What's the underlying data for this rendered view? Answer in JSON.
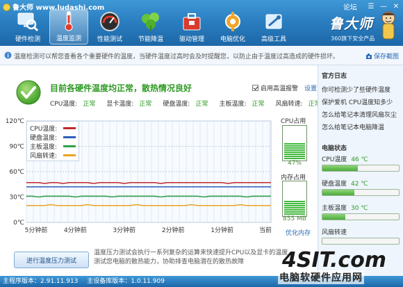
{
  "app": {
    "title": "鲁大师 www.ludashi.com",
    "forum": "论坛",
    "brand_name": "鲁大师",
    "brand_slogan": "360旗下安全产品"
  },
  "nav": [
    {
      "label": "硬件检测",
      "icon": "monitor-magnifier-icon",
      "active": false
    },
    {
      "label": "温度监测",
      "icon": "thermometer-icon",
      "active": true
    },
    {
      "label": "性能测试",
      "icon": "speedometer-icon",
      "active": false
    },
    {
      "label": "节能降温",
      "icon": "leaf-icon",
      "active": false
    },
    {
      "label": "驱动管理",
      "icon": "toolbox-icon",
      "active": false
    },
    {
      "label": "电脑优化",
      "icon": "gear-shield-icon",
      "active": false
    },
    {
      "label": "高级工具",
      "icon": "tools-icon",
      "active": false
    }
  ],
  "notice": {
    "text": "温度检测可以帮您查看各个重要硬件的温度，当硬件温度过高时会及时提醒您，以防止由于温度过高造成的硬件损坏。",
    "save_log": "保存截图"
  },
  "status": {
    "title": "目前各硬件温度均正常，散热情况良好",
    "alarm_label": "启用高温报警",
    "alarm_checked": true,
    "setting": "设置"
  },
  "sensors": [
    {
      "label": "CPU温度:",
      "value": "正常"
    },
    {
      "label": "显卡温度:",
      "value": "正常"
    },
    {
      "label": "硬盘温度:",
      "value": "正常"
    },
    {
      "label": "主板温度:",
      "value": "正常"
    },
    {
      "label": "风扇转速:",
      "value": "正常"
    }
  ],
  "chart_data": {
    "type": "line",
    "y_ticks": [
      "120℃",
      "90℃",
      "60℃",
      "30℃",
      "0℃"
    ],
    "ylim": [
      0,
      120
    ],
    "x_ticks": [
      "5分钟前",
      "4分钟前",
      "3分钟前",
      "2分钟前",
      "1分钟前",
      "当前"
    ],
    "grid": true,
    "legend_position": "top-left",
    "series": [
      {
        "name": "CPU温度:",
        "color": "#c0282a",
        "values": [
          47,
          47,
          47,
          46,
          47,
          47,
          46,
          47,
          47,
          47,
          47,
          46,
          47,
          47,
          47,
          47,
          46,
          47,
          47,
          47,
          47,
          47,
          46,
          47,
          47,
          47,
          47,
          47,
          47,
          47,
          47,
          47,
          47,
          46,
          47,
          47,
          47,
          47,
          47,
          47,
          47
        ]
      },
      {
        "name": "硬盘温度:",
        "color": "#2d5cb8",
        "values": [
          42,
          42,
          42,
          42,
          42,
          42,
          42,
          42,
          42,
          42,
          42,
          42,
          42,
          42,
          42,
          42,
          42,
          42,
          42,
          42,
          42,
          42,
          42,
          42,
          42,
          42,
          42,
          42,
          42,
          42,
          42,
          42,
          42,
          42,
          42,
          42,
          42,
          42,
          42,
          42,
          42
        ]
      },
      {
        "name": "主板温度:",
        "color": "#2fa14a",
        "values": [
          31,
          31,
          30,
          31,
          31,
          31,
          31,
          31,
          30,
          31,
          31,
          31,
          31,
          31,
          30,
          31,
          31,
          31,
          31,
          31,
          31,
          31,
          30,
          31,
          31,
          31,
          31,
          31,
          31,
          30,
          31,
          31,
          31,
          31,
          31,
          31,
          30,
          31,
          31,
          31,
          31
        ]
      },
      {
        "name": "风扇转速:",
        "color": "#e8a323",
        "values": [
          20,
          20,
          20,
          20,
          21,
          20,
          20,
          20,
          20,
          20,
          21,
          20,
          20,
          20,
          20,
          20,
          20,
          20,
          21,
          20,
          20,
          20,
          20,
          20,
          20,
          20,
          20,
          21,
          20,
          20,
          20,
          20,
          20,
          20,
          20,
          21,
          20,
          20,
          20,
          20,
          20
        ]
      }
    ]
  },
  "meters": {
    "cpu_title": "CPU占用",
    "cpu_value": "47%",
    "cpu_fraction": 0.47,
    "mem_title": "内存占用",
    "mem_value": "855 MB",
    "mem_fraction": 0.45,
    "optimize": "优化内存"
  },
  "stress": {
    "button": "进行温度压力测试",
    "desc": "温度压力测试会执行一系列复杂的运算来快速提升CPU以及显卡的温度，测试您电脑的散热能力，协助排查电脑潜在的散热故障"
  },
  "sidebar": {
    "news_title": "官方日志",
    "news": [
      "你可检测少了些硬件温度",
      "保护爱机 CPU温度知多少",
      "怎么给笔记本清理风扇灰尘",
      "怎么给笔记本电脑降温"
    ],
    "hw_title": "电脑状态",
    "hw": [
      {
        "label": "CPU温度",
        "value": "46 ℃",
        "fraction": 0.46
      },
      {
        "label": "硬盘温度",
        "value": "42 ℃",
        "fraction": 0.42
      },
      {
        "label": "主板温度",
        "value": "30 ℃",
        "fraction": 0.3
      },
      {
        "label": "风扇转速",
        "value": "",
        "fraction": 0.0
      }
    ]
  },
  "statusbar": {
    "main_version": "主程序版本：2.91.11.913",
    "db_version": "主设备库版本：1.0.11.909"
  },
  "watermark": {
    "logo": "4SIT.com",
    "text": "电脑软硬件应用网"
  }
}
